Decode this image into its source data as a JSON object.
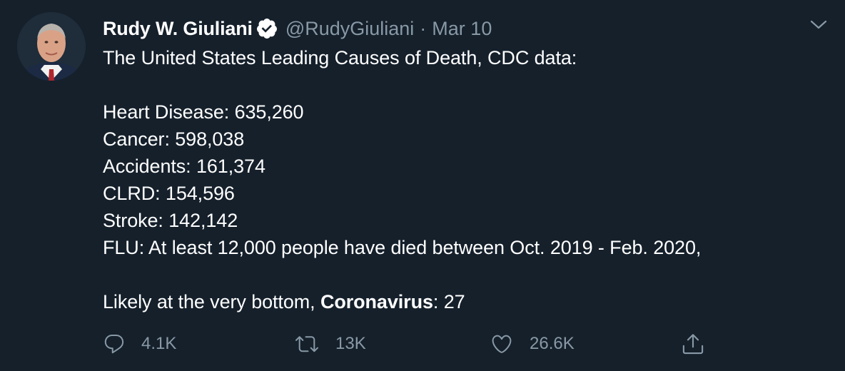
{
  "tweet": {
    "author_name": "Rudy W. Giuliani",
    "handle": "@RudyGiuliani",
    "separator": "·",
    "date": "Mar 10",
    "lines": {
      "l1": "The United States Leading Causes of Death, CDC data:",
      "l2": "Heart Disease: 635,260",
      "l3": "Cancer: 598,038",
      "l4": "Accidents: 161,374",
      "l5": "CLRD: 154,596",
      "l6": "Stroke: 142,142",
      "l7": "FLU: At least 12,000 people have died between Oct. 2019 - Feb. 2020,",
      "l8_prefix": "Likely at the very bottom, ",
      "l8_bold": "Coronavirus",
      "l8_suffix": ": 27"
    },
    "actions": {
      "reply_count": "4.1K",
      "retweet_count": "13K",
      "like_count": "26.6K"
    }
  },
  "icons": {
    "avatar": "avatar-photo",
    "verified": "verified-badge-icon",
    "caret": "chevron-down-icon",
    "reply": "reply-icon",
    "retweet": "retweet-icon",
    "like": "heart-icon",
    "share": "share-icon"
  },
  "colors": {
    "background": "#15202b",
    "text_primary": "#ffffff",
    "text_secondary": "#8899a6"
  }
}
